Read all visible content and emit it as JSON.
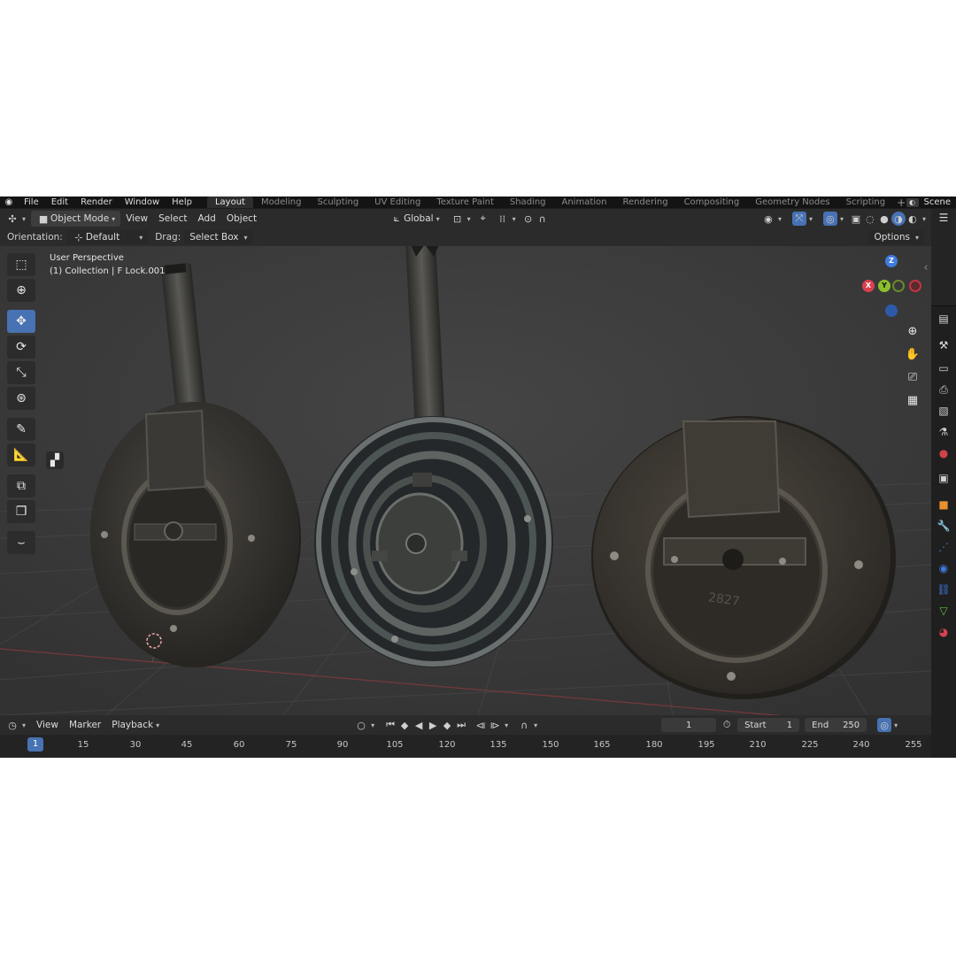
{
  "menu": {
    "items": [
      "File",
      "Edit",
      "Render",
      "Window",
      "Help"
    ],
    "workspaces": [
      "Layout",
      "Modeling",
      "Sculpting",
      "UV Editing",
      "Texture Paint",
      "Shading",
      "Animation",
      "Rendering",
      "Compositing",
      "Geometry Nodes",
      "Scripting"
    ],
    "active_workspace": "Layout",
    "add_symbol": "+",
    "scene_label": "Scene"
  },
  "header": {
    "mode": "Object Mode",
    "menus": [
      "View",
      "Select",
      "Add",
      "Object"
    ],
    "transform_orientation": "Global",
    "options_label": "Options"
  },
  "tool_settings": {
    "orientation_label": "Orientation:",
    "orientation_value": "Default",
    "drag_label": "Drag:",
    "drag_value": "Select Box"
  },
  "viewport": {
    "perspective_label": "User Perspective",
    "collection_label": "(1) Collection | F Lock.001",
    "gizmo_axes": {
      "z": "Z",
      "y": "Y",
      "x": "X"
    },
    "engraving": "2827"
  },
  "timeline": {
    "menus": [
      "View",
      "Marker",
      "Playback"
    ],
    "current_frame": "1",
    "start_label": "Start",
    "start_value": "1",
    "end_label": "End",
    "end_value": "250",
    "ruler_ticks": [
      "1",
      "15",
      "30",
      "45",
      "60",
      "75",
      "90",
      "105",
      "120",
      "135",
      "150",
      "165",
      "180",
      "195",
      "210",
      "225",
      "240",
      "255"
    ]
  },
  "colors": {
    "accent": "#4772b3",
    "x_axis": "#d9404f",
    "y_axis": "#8bbf2d",
    "z_axis": "#3f7be0",
    "background_viewport": "#3a3a3a"
  }
}
